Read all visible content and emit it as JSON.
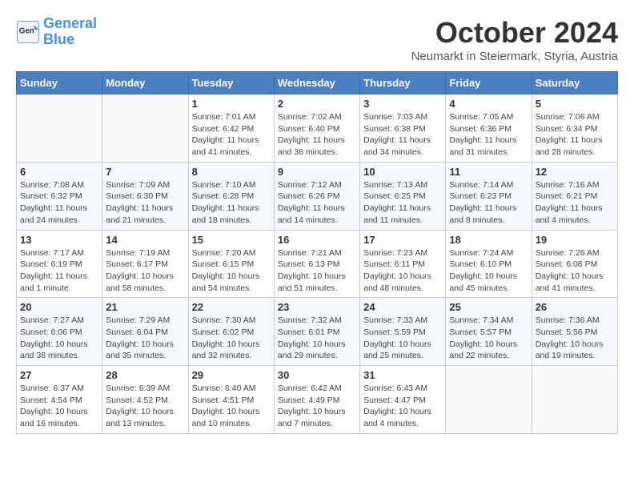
{
  "header": {
    "logo_line1": "General",
    "logo_line2": "Blue",
    "month": "October 2024",
    "location": "Neumarkt in Steiermark, Styria, Austria"
  },
  "weekdays": [
    "Sunday",
    "Monday",
    "Tuesday",
    "Wednesday",
    "Thursday",
    "Friday",
    "Saturday"
  ],
  "weeks": [
    [
      {
        "day": "",
        "info": ""
      },
      {
        "day": "",
        "info": ""
      },
      {
        "day": "1",
        "info": "Sunrise: 7:01 AM\nSunset: 6:42 PM\nDaylight: 11 hours and 41 minutes."
      },
      {
        "day": "2",
        "info": "Sunrise: 7:02 AM\nSunset: 6:40 PM\nDaylight: 11 hours and 38 minutes."
      },
      {
        "day": "3",
        "info": "Sunrise: 7:03 AM\nSunset: 6:38 PM\nDaylight: 11 hours and 34 minutes."
      },
      {
        "day": "4",
        "info": "Sunrise: 7:05 AM\nSunset: 6:36 PM\nDaylight: 11 hours and 31 minutes."
      },
      {
        "day": "5",
        "info": "Sunrise: 7:06 AM\nSunset: 6:34 PM\nDaylight: 11 hours and 28 minutes."
      }
    ],
    [
      {
        "day": "6",
        "info": "Sunrise: 7:08 AM\nSunset: 6:32 PM\nDaylight: 11 hours and 24 minutes."
      },
      {
        "day": "7",
        "info": "Sunrise: 7:09 AM\nSunset: 6:30 PM\nDaylight: 11 hours and 21 minutes."
      },
      {
        "day": "8",
        "info": "Sunrise: 7:10 AM\nSunset: 6:28 PM\nDaylight: 11 hours and 18 minutes."
      },
      {
        "day": "9",
        "info": "Sunrise: 7:12 AM\nSunset: 6:26 PM\nDaylight: 11 hours and 14 minutes."
      },
      {
        "day": "10",
        "info": "Sunrise: 7:13 AM\nSunset: 6:25 PM\nDaylight: 11 hours and 11 minutes."
      },
      {
        "day": "11",
        "info": "Sunrise: 7:14 AM\nSunset: 6:23 PM\nDaylight: 11 hours and 8 minutes."
      },
      {
        "day": "12",
        "info": "Sunrise: 7:16 AM\nSunset: 6:21 PM\nDaylight: 11 hours and 4 minutes."
      }
    ],
    [
      {
        "day": "13",
        "info": "Sunrise: 7:17 AM\nSunset: 6:19 PM\nDaylight: 11 hours and 1 minute."
      },
      {
        "day": "14",
        "info": "Sunrise: 7:19 AM\nSunset: 6:17 PM\nDaylight: 10 hours and 58 minutes."
      },
      {
        "day": "15",
        "info": "Sunrise: 7:20 AM\nSunset: 6:15 PM\nDaylight: 10 hours and 54 minutes."
      },
      {
        "day": "16",
        "info": "Sunrise: 7:21 AM\nSunset: 6:13 PM\nDaylight: 10 hours and 51 minutes."
      },
      {
        "day": "17",
        "info": "Sunrise: 7:23 AM\nSunset: 6:11 PM\nDaylight: 10 hours and 48 minutes."
      },
      {
        "day": "18",
        "info": "Sunrise: 7:24 AM\nSunset: 6:10 PM\nDaylight: 10 hours and 45 minutes."
      },
      {
        "day": "19",
        "info": "Sunrise: 7:26 AM\nSunset: 6:08 PM\nDaylight: 10 hours and 41 minutes."
      }
    ],
    [
      {
        "day": "20",
        "info": "Sunrise: 7:27 AM\nSunset: 6:06 PM\nDaylight: 10 hours and 38 minutes."
      },
      {
        "day": "21",
        "info": "Sunrise: 7:29 AM\nSunset: 6:04 PM\nDaylight: 10 hours and 35 minutes."
      },
      {
        "day": "22",
        "info": "Sunrise: 7:30 AM\nSunset: 6:02 PM\nDaylight: 10 hours and 32 minutes."
      },
      {
        "day": "23",
        "info": "Sunrise: 7:32 AM\nSunset: 6:01 PM\nDaylight: 10 hours and 29 minutes."
      },
      {
        "day": "24",
        "info": "Sunrise: 7:33 AM\nSunset: 5:59 PM\nDaylight: 10 hours and 25 minutes."
      },
      {
        "day": "25",
        "info": "Sunrise: 7:34 AM\nSunset: 5:57 PM\nDaylight: 10 hours and 22 minutes."
      },
      {
        "day": "26",
        "info": "Sunrise: 7:36 AM\nSunset: 5:56 PM\nDaylight: 10 hours and 19 minutes."
      }
    ],
    [
      {
        "day": "27",
        "info": "Sunrise: 6:37 AM\nSunset: 4:54 PM\nDaylight: 10 hours and 16 minutes."
      },
      {
        "day": "28",
        "info": "Sunrise: 6:39 AM\nSunset: 4:52 PM\nDaylight: 10 hours and 13 minutes."
      },
      {
        "day": "29",
        "info": "Sunrise: 6:40 AM\nSunset: 4:51 PM\nDaylight: 10 hours and 10 minutes."
      },
      {
        "day": "30",
        "info": "Sunrise: 6:42 AM\nSunset: 4:49 PM\nDaylight: 10 hours and 7 minutes."
      },
      {
        "day": "31",
        "info": "Sunrise: 6:43 AM\nSunset: 4:47 PM\nDaylight: 10 hours and 4 minutes."
      },
      {
        "day": "",
        "info": ""
      },
      {
        "day": "",
        "info": ""
      }
    ]
  ]
}
